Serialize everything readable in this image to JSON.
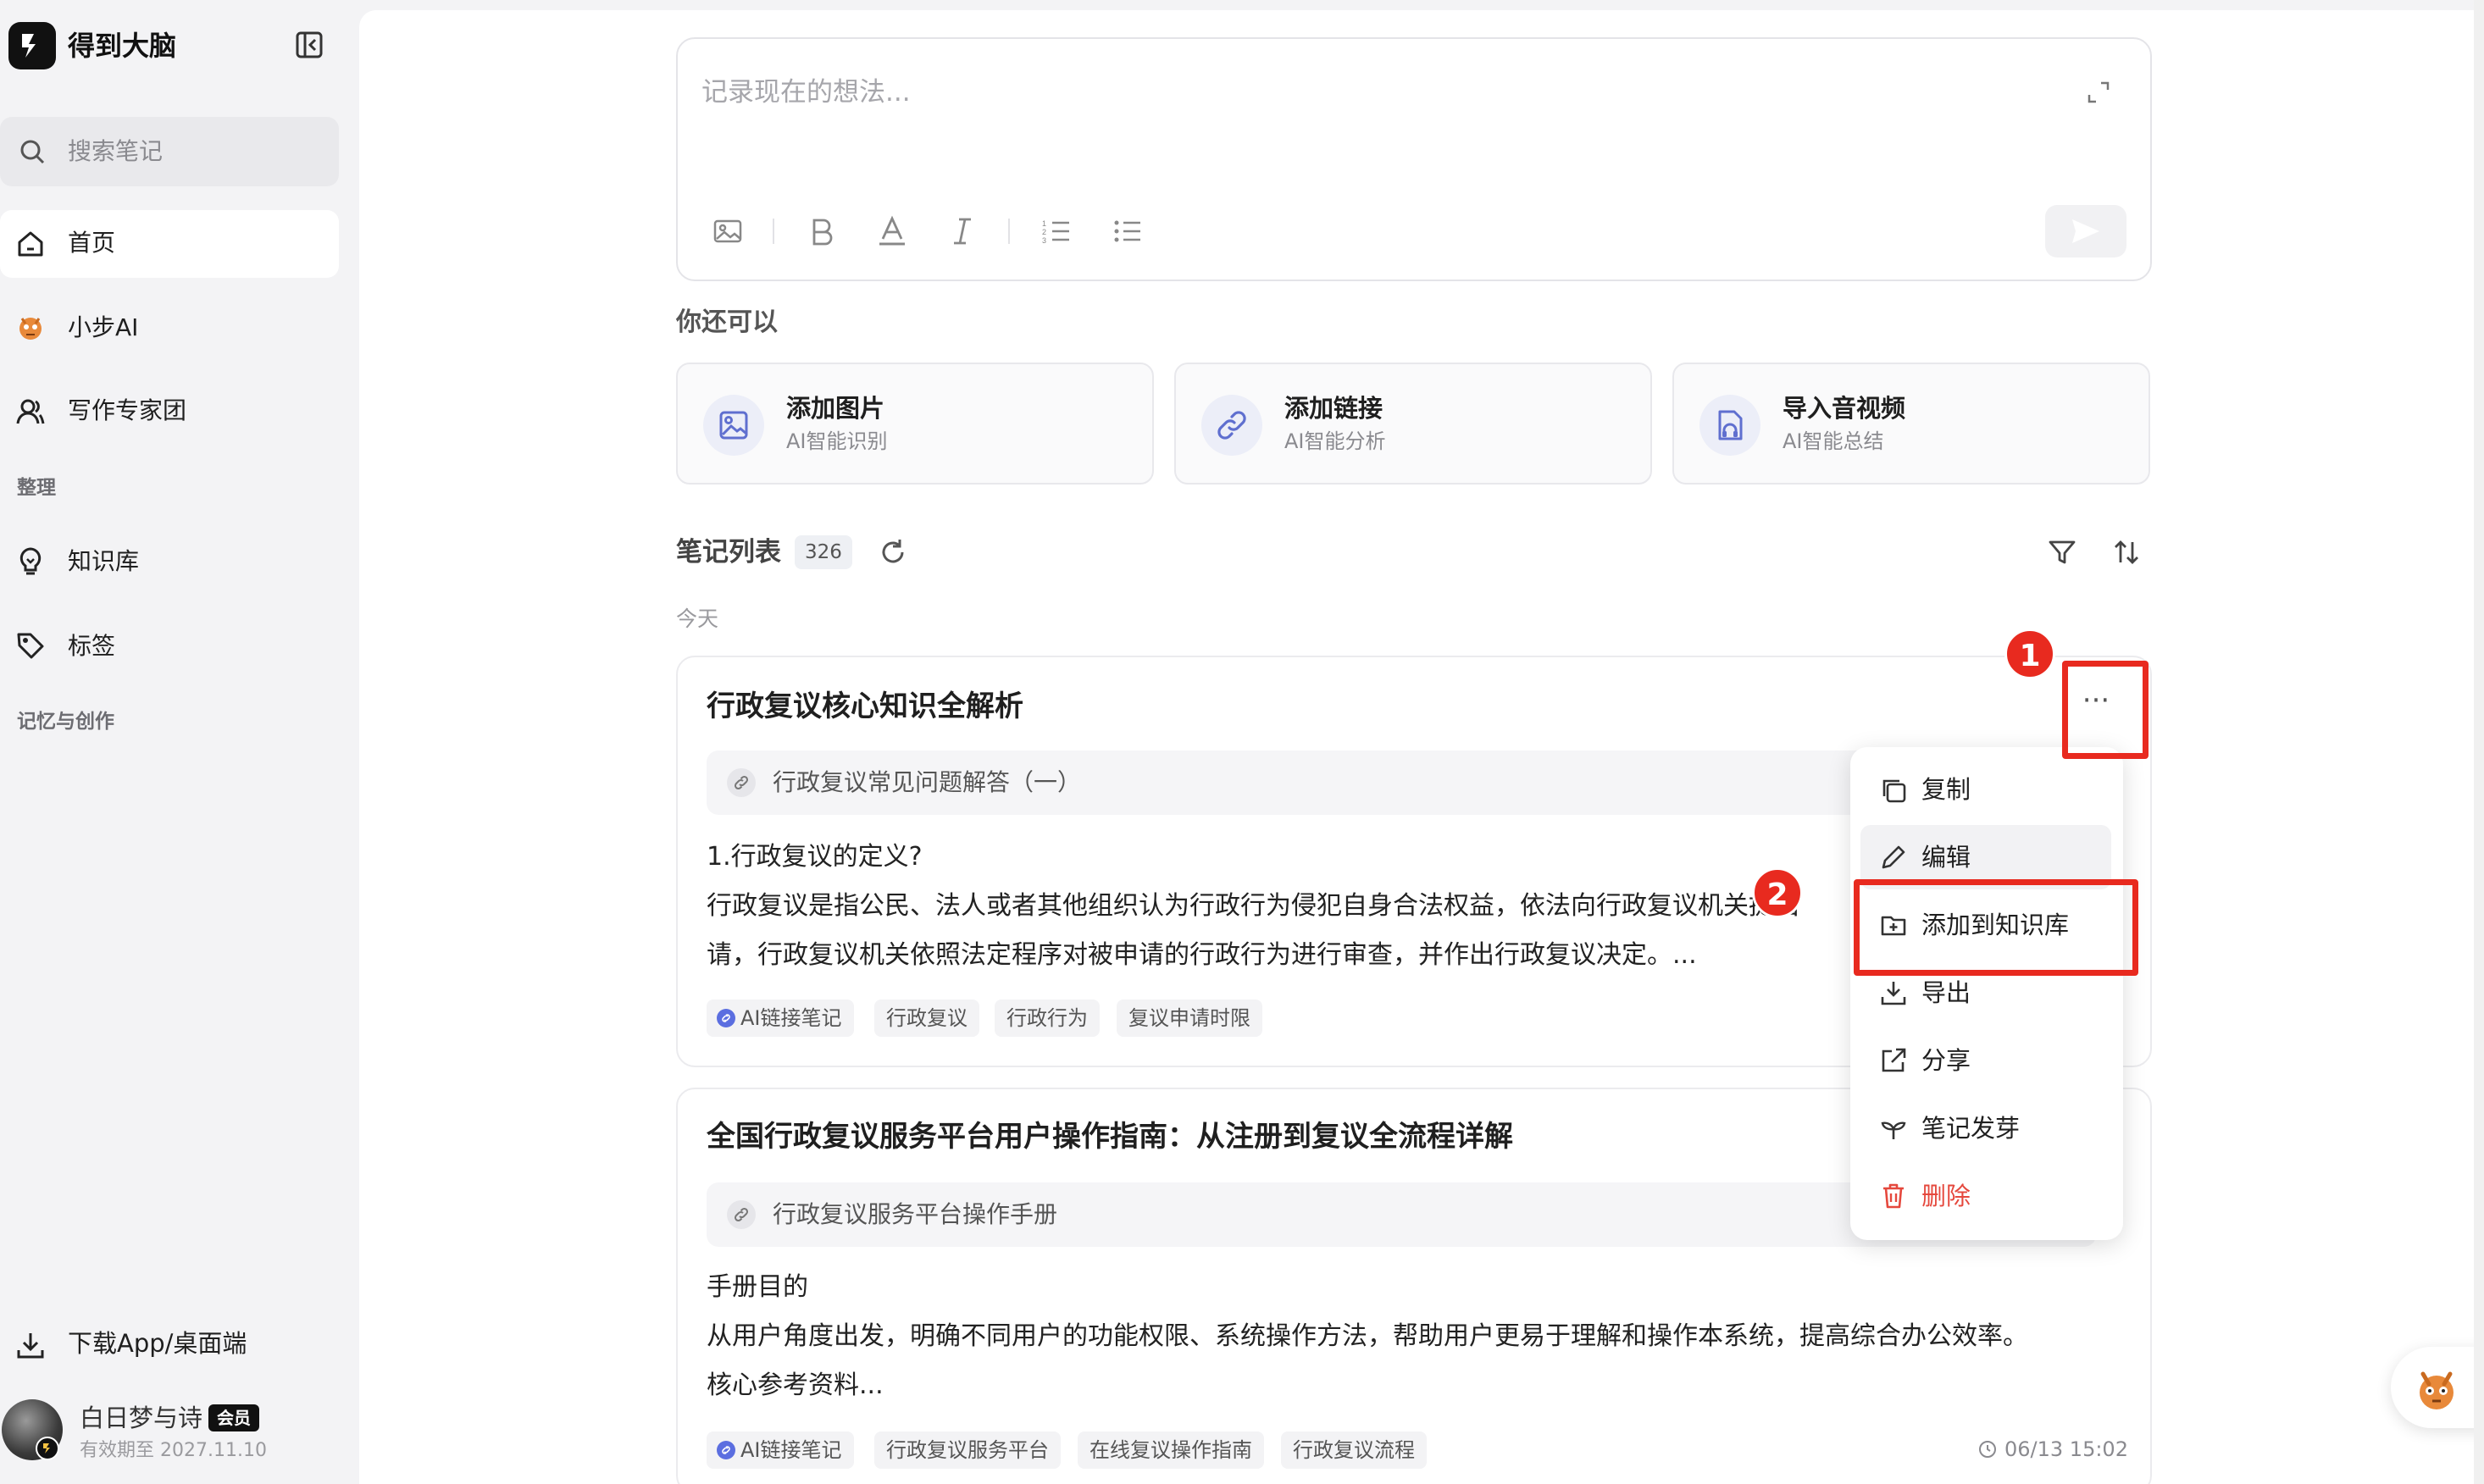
{
  "app": {
    "title": "得到大脑"
  },
  "sidebar": {
    "search_placeholder": "搜索笔记",
    "items": [
      {
        "label": "首页",
        "icon": "home-icon",
        "active": true
      },
      {
        "label": "小步AI",
        "icon": "mascot-icon"
      },
      {
        "label": "写作专家团",
        "icon": "user-icon"
      },
      {
        "label": "知识库",
        "icon": "lightbulb-icon"
      },
      {
        "label": "标签",
        "icon": "tag-icon"
      }
    ],
    "sections": [
      "整理",
      "记忆与创作"
    ],
    "download_label": "下载App/桌面端",
    "user": {
      "name": "白日梦与诗",
      "badge": "会员",
      "expire": "有效期至 2027.11.10"
    }
  },
  "editor": {
    "placeholder": "记录现在的想法..."
  },
  "also": {
    "label": "你还可以",
    "cards": [
      {
        "title": "添加图片",
        "sub": "AI智能识别",
        "icon": "image-icon"
      },
      {
        "title": "添加链接",
        "sub": "AI智能分析",
        "icon": "link-icon"
      },
      {
        "title": "导入音视频",
        "sub": "AI智能总结",
        "icon": "audio-file-icon"
      }
    ]
  },
  "list": {
    "title": "笔记列表",
    "count": "326",
    "group": "今天"
  },
  "notes": [
    {
      "title": "行政复议核心知识全解析",
      "source": "行政复议常见问题解答（一）",
      "lines": [
        "1.行政复议的定义?",
        "行政复议是指公民、法人或者其他组织认为行政行为侵犯自身合法权益，依法向行政复议机关提出",
        "请，行政复议机关依照法定程序对被申请的行政行为进行审查，并作出行政复议决定。..."
      ],
      "tags": [
        "AI链接笔记",
        "行政复议",
        "行政行为",
        "复议申请时限"
      ]
    },
    {
      "title": "全国行政复议服务平台用户操作指南：从注册到复议全流程详解",
      "source": "行政复议服务平台操作手册",
      "lines": [
        "手册目的",
        "从用户角度出发，明确不同用户的功能权限、系统操作方法，帮助用户更易于理解和操作本系统，提高综合办公效率。",
        "核心参考资料..."
      ],
      "tags": [
        "AI链接笔记",
        "行政复议服务平台",
        "在线复议操作指南",
        "行政复议流程"
      ],
      "time": "06/13 15:02"
    }
  ],
  "menu": {
    "items": [
      {
        "label": "复制",
        "icon": "copy-icon"
      },
      {
        "label": "编辑",
        "icon": "pencil-icon"
      },
      {
        "label": "添加到知识库",
        "icon": "folder-add-icon"
      },
      {
        "label": "导出",
        "icon": "download-icon"
      },
      {
        "label": "分享",
        "icon": "share-icon"
      },
      {
        "label": "笔记发芽",
        "icon": "sprout-icon"
      },
      {
        "label": "删除",
        "icon": "trash-icon",
        "danger": true
      }
    ]
  },
  "annotations": [
    "1",
    "2"
  ],
  "colors": {
    "accent": "#e82a1f",
    "danger": "#e5483d",
    "brand": "#111111"
  }
}
